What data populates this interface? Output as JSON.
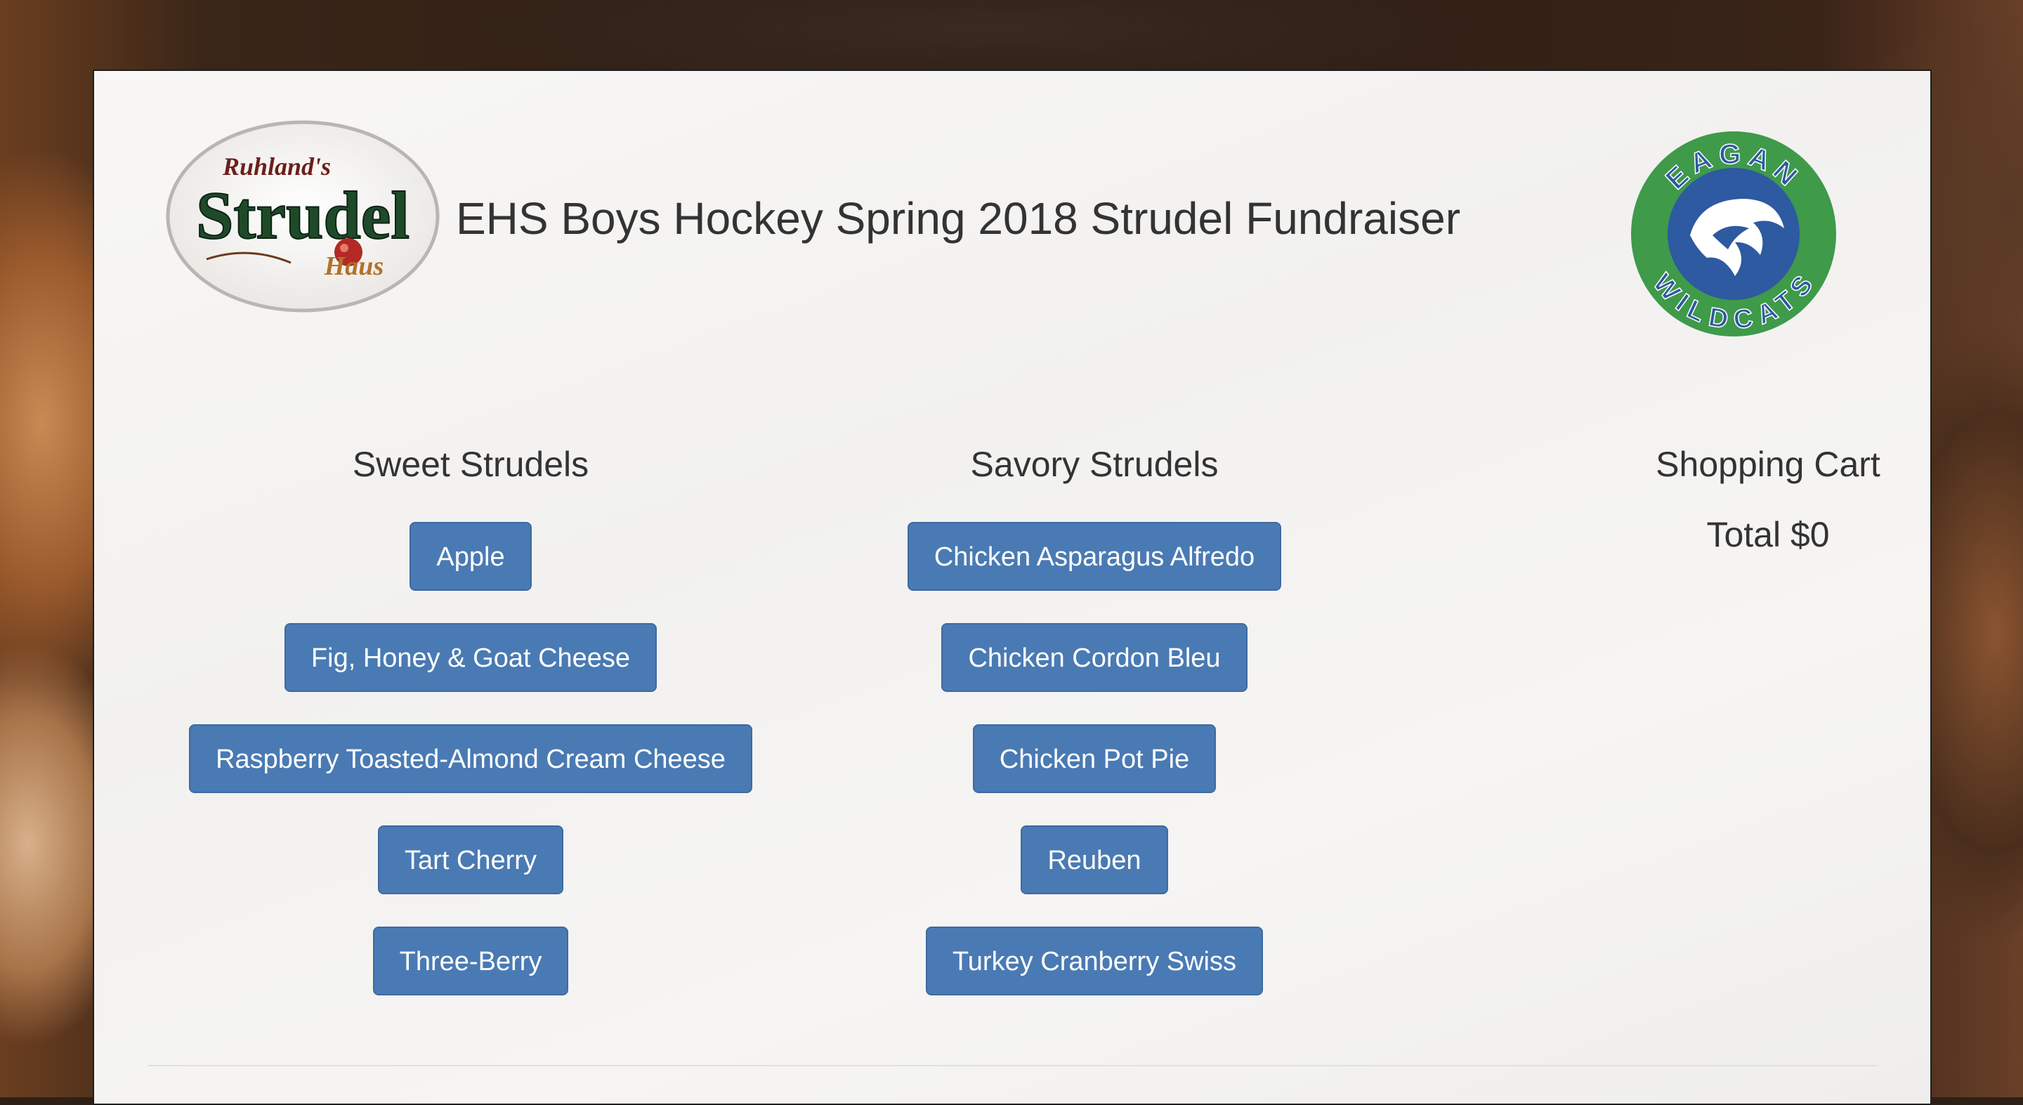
{
  "header": {
    "title": "EHS Boys Hockey Spring 2018 Strudel Fundraiser",
    "left_logo": {
      "icon": "strudel-haus-logo",
      "text_small": "Ruhland's",
      "text_main": "Strudel",
      "text_sub": "Haus"
    },
    "right_logo": {
      "icon": "eagan-wildcats-logo",
      "text_top": "EAGAN",
      "text_bottom": "WILDCATS"
    }
  },
  "sweet": {
    "heading": "Sweet Strudels",
    "items": [
      "Apple",
      "Fig, Honey & Goat Cheese",
      "Raspberry Toasted-Almond Cream Cheese",
      "Tart Cherry",
      "Three-Berry"
    ]
  },
  "savory": {
    "heading": "Savory Strudels",
    "items": [
      "Chicken Asparagus Alfredo",
      "Chicken Cordon Bleu",
      "Chicken Pot Pie",
      "Reuben",
      "Turkey Cranberry Swiss"
    ]
  },
  "cart": {
    "heading": "Shopping Cart",
    "total": "Total $0"
  },
  "colors": {
    "button": "#4a7ab3",
    "panel": "#f5f4f2",
    "text": "#333333",
    "logo_green": "#3f9a4a",
    "logo_blue": "#2d5aa0"
  }
}
